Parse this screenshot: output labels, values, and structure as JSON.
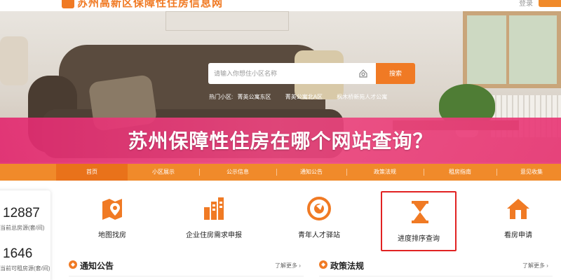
{
  "header": {
    "site_name": "苏州高新区保障性住房信息网",
    "top_link": "登录"
  },
  "search": {
    "placeholder": "请输入你想住小区名称",
    "button": "搜索",
    "hot_label": "热门小区:",
    "hot_items": [
      "菁英公寓东区",
      "菁英公寓北A区",
      "枫木桥新苑人才公寓"
    ]
  },
  "banner_title": "苏州保障性住房在哪个网站查询？",
  "nav": {
    "items": [
      "首页",
      "小区展示",
      "公示信息",
      "通知公告",
      "政策法规",
      "租房指南",
      "意见收集"
    ],
    "active_index": 0
  },
  "stats": [
    {
      "value": "12887",
      "label": "当前总房源(套/间)"
    },
    {
      "value": "1646",
      "label": "当前可租房源(套/间)"
    }
  ],
  "features": [
    {
      "label": "地图找房",
      "icon": "map-pin-icon"
    },
    {
      "label": "企业住房需求申报",
      "icon": "building-chart-icon"
    },
    {
      "label": "青年人才驿站",
      "icon": "target-bird-icon"
    },
    {
      "label": "进度排序查询",
      "icon": "hourglass-icon",
      "highlighted": true
    },
    {
      "label": "看房申请",
      "icon": "house-icon"
    }
  ],
  "sections": {
    "notice": {
      "title": "通知公告",
      "more": "了解更多"
    },
    "policy": {
      "title": "政策法规",
      "more": "了解更多"
    }
  },
  "colors": {
    "accent": "#f07a24",
    "nav_bg": "#f08a2a",
    "banner_pink": "#e6337a",
    "highlight_border": "#e12222"
  }
}
